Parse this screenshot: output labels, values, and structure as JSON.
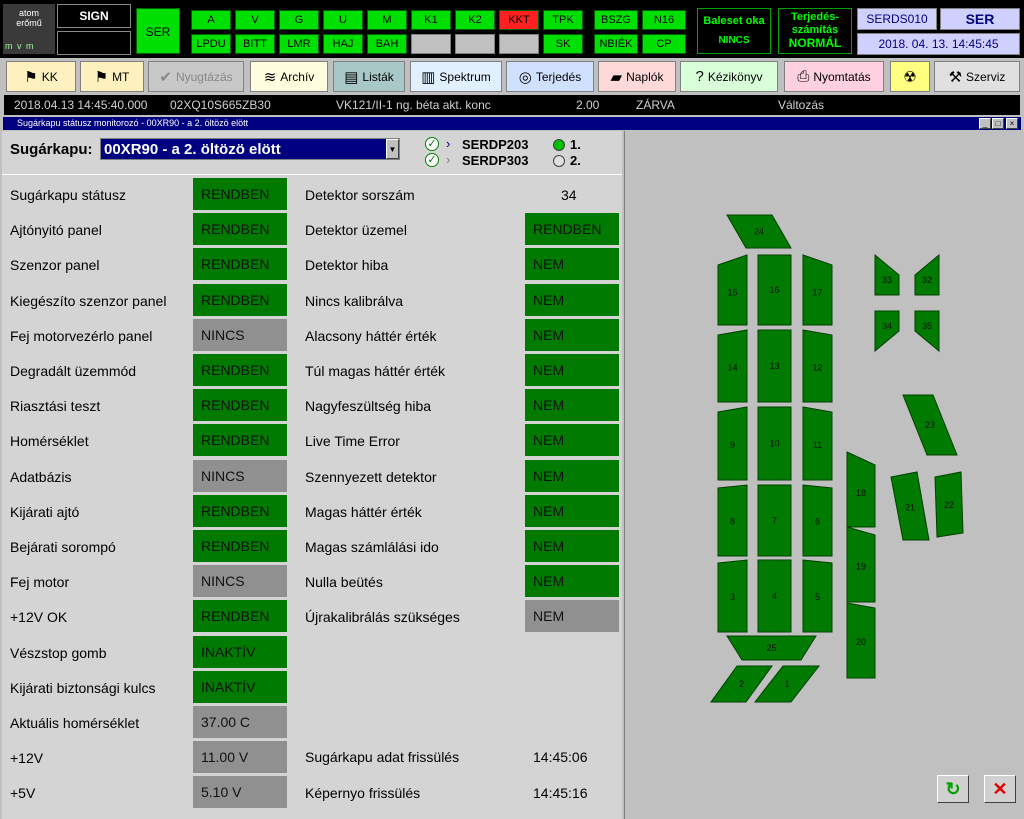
{
  "topbar": {
    "logo_line1": "atom",
    "logo_line2": "erőmű",
    "logo_mvm": "m v m",
    "sign": "SIGN",
    "ser_btn": "SER",
    "row1": [
      "A",
      "V",
      "G",
      "U",
      "M",
      "K1",
      "K2",
      "KKT",
      "TPK"
    ],
    "row2": [
      "LPDU",
      "BITT",
      "LMR",
      "HAJ",
      "BAH",
      "",
      "",
      "",
      "SK"
    ],
    "grp3_row1": [
      "BSZG",
      "N16"
    ],
    "grp3_row2": [
      "NBIÉK",
      "CP"
    ],
    "baleset_line1": "Baleset oka",
    "baleset_line2": "NINCS",
    "terjedes_line1": "Terjedés-",
    "terjedes_line2": "számítás",
    "terjedes_line3": "NORMÁL",
    "server": "SERDS010",
    "ser_label": "SER",
    "datetime": "2018. 04. 13.   14:45:45",
    "colors": {
      "green": "#00e000",
      "red": "#ff2020",
      "black": "#000000"
    }
  },
  "toolbar": [
    {
      "label": "KK",
      "icon": "tree-icon",
      "glyph": "⚑",
      "bg": "#fff0c0"
    },
    {
      "label": "MT",
      "icon": "tree-icon",
      "glyph": "⚑",
      "bg": "#fff0c0"
    },
    {
      "label": "Nyugtázás",
      "icon": "check-icon",
      "glyph": "✔",
      "bg": "#c8c8c8",
      "disabled": true
    },
    {
      "label": "Archív",
      "icon": "rainbow-icon",
      "glyph": "≋",
      "bg": "#ffffe0"
    },
    {
      "label": "Listák",
      "icon": "list-icon",
      "glyph": "▤",
      "bg": "#a8c8c8"
    },
    {
      "label": "Spektrum",
      "icon": "chart-icon",
      "glyph": "▥",
      "bg": "#e0f0ff"
    },
    {
      "label": "Terjedés",
      "icon": "target-icon",
      "glyph": "◎",
      "bg": "#d0e0ff"
    },
    {
      "label": "Naplók",
      "icon": "book-icon",
      "glyph": "▰",
      "bg": "#ffd8d8"
    },
    {
      "label": "Kézikönyv",
      "icon": "help-icon",
      "glyph": "?",
      "bg": "#d8ffd8"
    },
    {
      "label": "Nyomtatás",
      "icon": "printer-icon",
      "glyph": "⎙",
      "bg": "#ffd0e0"
    },
    {
      "label": "",
      "icon": "radiation-icon",
      "glyph": "☢",
      "bg": "#ffff80"
    },
    {
      "label": "Szerviz",
      "icon": "tools-icon",
      "glyph": "⚒",
      "bg": "#e0e0e0"
    }
  ],
  "infoline": {
    "timestamp": "2018.04.13 14:45:40.000",
    "code": "02XQ10S665ZB30",
    "desc": "VK121/II-1 ng. béta akt. konc",
    "value": "2.00",
    "state": "ZÁRVA",
    "change": "Változás"
  },
  "window": {
    "title": "Sugárkapu státusz monitorozó - 00XR90 - a 2. öltözö elött"
  },
  "selector": {
    "label": "Sugárkapu:",
    "value": "00XR90 - a 2. öltözö elött",
    "server1": "SERDP203",
    "server2": "SERDP303",
    "radio1": "1.",
    "radio2": "2."
  },
  "left_rows": [
    {
      "label": "Sugárkapu státusz",
      "value": "RENDBEN",
      "state": "ok"
    },
    {
      "label": "Ajtónyitó panel",
      "value": "RENDBEN",
      "state": "ok"
    },
    {
      "label": "Szenzor panel",
      "value": "RENDBEN",
      "state": "ok"
    },
    {
      "label": "Kiegészíto szenzor panel",
      "value": "RENDBEN",
      "state": "ok"
    },
    {
      "label": "Fej motorvezérlo panel",
      "value": "NINCS",
      "state": "none"
    },
    {
      "label": "Degradált üzemmód",
      "value": "RENDBEN",
      "state": "ok"
    },
    {
      "label": "Riasztási teszt",
      "value": "RENDBEN",
      "state": "ok"
    },
    {
      "label": "Homérséklet",
      "value": "RENDBEN",
      "state": "ok"
    },
    {
      "label": "Adatbázis",
      "value": "NINCS",
      "state": "none"
    },
    {
      "label": "Kijárati ajtó",
      "value": "RENDBEN",
      "state": "ok"
    },
    {
      "label": "Bejárati sorompó",
      "value": "RENDBEN",
      "state": "ok"
    },
    {
      "label": "Fej motor",
      "value": "NINCS",
      "state": "none"
    },
    {
      "label": "+12V OK",
      "value": "RENDBEN",
      "state": "ok"
    },
    {
      "label": "Vészstop gomb",
      "value": "INAKTÍV",
      "state": "ok"
    },
    {
      "label": "Kijárati biztonsági kulcs",
      "value": "INAKTÍV",
      "state": "ok"
    },
    {
      "label": "Aktuális homérséklet",
      "value": "37.00 C",
      "state": "none"
    },
    {
      "label": "+12V",
      "value": "11.00 V",
      "state": "none"
    },
    {
      "label": "+5V",
      "value": "5.10 V",
      "state": "none"
    }
  ],
  "right_rows": [
    {
      "label": "Detektor sorszám",
      "value": "34",
      "state": "plain"
    },
    {
      "label": "Detektor üzemel",
      "value": "RENDBEN",
      "state": "ok"
    },
    {
      "label": "Detektor hiba",
      "value": "NEM",
      "state": "ok"
    },
    {
      "label": "Nincs kalibrálva",
      "value": "NEM",
      "state": "ok"
    },
    {
      "label": "Alacsony háttér érték",
      "value": "NEM",
      "state": "ok"
    },
    {
      "label": "Túl magas háttér érték",
      "value": "NEM",
      "state": "ok"
    },
    {
      "label": "Nagyfeszültség hiba",
      "value": "NEM",
      "state": "ok"
    },
    {
      "label": "Live Time Error",
      "value": "NEM",
      "state": "ok"
    },
    {
      "label": "Szennyezett detektor",
      "value": "NEM",
      "state": "ok"
    },
    {
      "label": "Magas háttér érték",
      "value": "NEM",
      "state": "ok"
    },
    {
      "label": "Magas számlálási ido",
      "value": "NEM",
      "state": "ok"
    },
    {
      "label": "Nulla beütés",
      "value": "NEM",
      "state": "ok"
    },
    {
      "label": "Újrakalibrálás szükséges",
      "value": "NEM",
      "state": "none"
    }
  ],
  "refresh": {
    "data_label": "Sugárkapu adat frissülés",
    "data_time": "14:45:06",
    "screen_label": "Képernyo frissülés",
    "screen_time": "14:45:16"
  },
  "detectors": [
    "1",
    "2",
    "3",
    "4",
    "5",
    "6",
    "7",
    "8",
    "9",
    "10",
    "11",
    "12",
    "13",
    "14",
    "15",
    "16",
    "17",
    "18",
    "19",
    "20",
    "21",
    "22",
    "23",
    "24",
    "25",
    "32",
    "33",
    "34",
    "35"
  ],
  "bottom_buttons": {
    "refresh_icon": "refresh-icon",
    "close_icon": "close-icon"
  }
}
